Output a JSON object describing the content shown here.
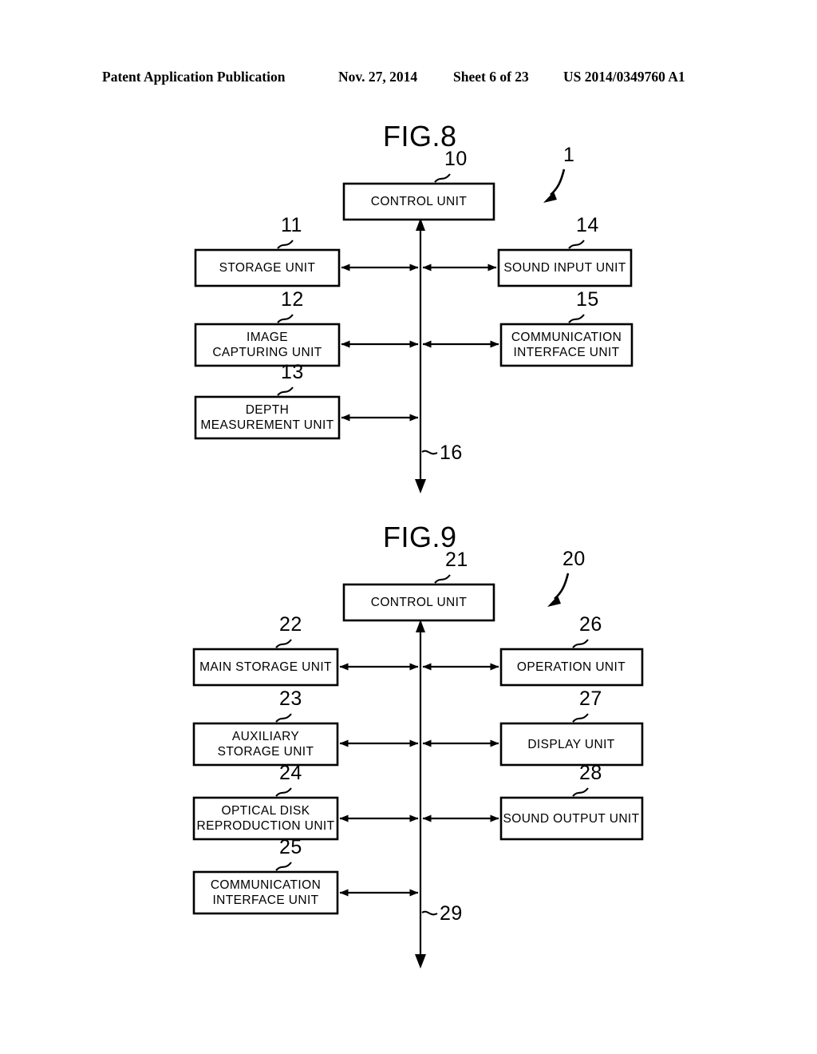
{
  "header": {
    "publication": "Patent Application Publication",
    "date": "Nov. 27, 2014",
    "sheet": "Sheet 6 of 23",
    "patent_number": "US 2014/0349760 A1"
  },
  "figures": [
    {
      "title": "FIG.8",
      "system_ref": "1",
      "bus_ref": "16",
      "control_unit": {
        "label": "CONTROL UNIT",
        "ref": "10"
      },
      "left_blocks": [
        {
          "label": "STORAGE UNIT",
          "ref": "11"
        },
        {
          "label": "IMAGE\nCAPTURING UNIT",
          "ref": "12"
        },
        {
          "label": "DEPTH\nMEASUREMENT UNIT",
          "ref": "13"
        }
      ],
      "right_blocks": [
        {
          "label": "SOUND INPUT UNIT",
          "ref": "14"
        },
        {
          "label": "COMMUNICATION\nINTERFACE UNIT",
          "ref": "15"
        }
      ]
    },
    {
      "title": "FIG.9",
      "system_ref": "20",
      "bus_ref": "29",
      "control_unit": {
        "label": "CONTROL UNIT",
        "ref": "21"
      },
      "left_blocks": [
        {
          "label": "MAIN STORAGE UNIT",
          "ref": "22"
        },
        {
          "label": "AUXILIARY\nSTORAGE UNIT",
          "ref": "23"
        },
        {
          "label": "OPTICAL DISK\nREPRODUCTION UNIT",
          "ref": "24"
        },
        {
          "label": "COMMUNICATION\nINTERFACE UNIT",
          "ref": "25"
        }
      ],
      "right_blocks": [
        {
          "label": "OPERATION UNIT",
          "ref": "26"
        },
        {
          "label": "DISPLAY UNIT",
          "ref": "27"
        },
        {
          "label": "SOUND OUTPUT UNIT",
          "ref": "28"
        }
      ]
    }
  ],
  "colors": {
    "ink": "#000000",
    "paper": "#ffffff"
  }
}
